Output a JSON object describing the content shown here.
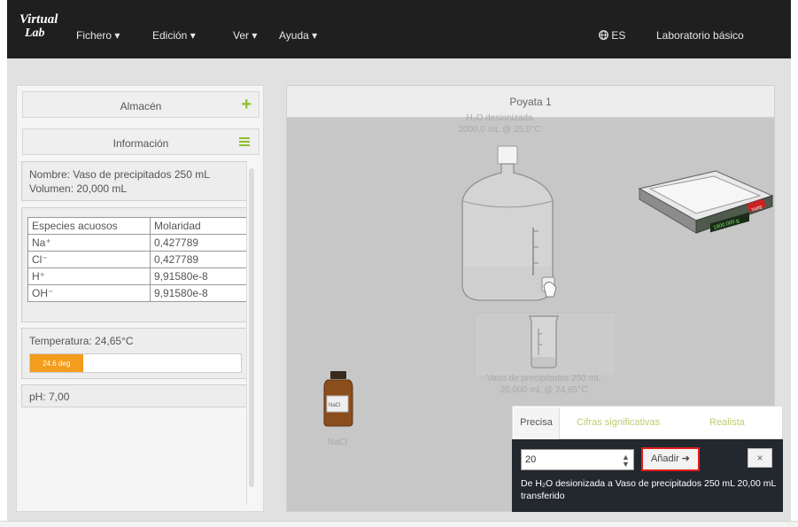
{
  "app": {
    "logo_line1": "Virtual",
    "logo_line2": "Lab",
    "menu": [
      "Fichero ▾",
      "Edición ▾",
      "Ver ▾",
      "Ayuda ▾"
    ],
    "language": "ES",
    "lab_name": "Laboratorio básico"
  },
  "left_panel": {
    "almacen_title": "Almacén",
    "info_title": "Información",
    "name_line": "Nombre: Vaso de precipitados 250 mL",
    "volume_line": "Volumen: 20,000 mL",
    "species_headers": [
      "Especies acuosos",
      "Molaridad"
    ],
    "species_rows": [
      [
        "Na⁺",
        "0,427789"
      ],
      [
        "Cl⁻",
        "0,427789"
      ],
      [
        "H⁺",
        "9,91580e-8"
      ],
      [
        "OH⁻",
        "9,91580e-8"
      ]
    ],
    "temperature_label": "Temperatura: 24,65°C",
    "temperature_bar_text": "24.6 deg",
    "temperature_fraction": 0.25,
    "ph_label": "pH: 7,00"
  },
  "bench": {
    "title": "Poyata 1",
    "water_label": "H₂O desionizada",
    "water_volume": "2000,0 mL @ 25,0°C",
    "scale_readout": "1800.000 g",
    "scale_tare": "TARE",
    "beaker_label": "Vaso de precipitados 250 mL",
    "beaker_volume": "20,000 mL @ 24,65°C",
    "nacl_label": "NaCl",
    "bottle_label": "NaCl"
  },
  "popover": {
    "tabs": [
      "Precisa",
      "Cifras significativas",
      "Realista"
    ],
    "input_value": "20",
    "add_label": "Añadir ➜",
    "close_label": "×",
    "message": "De H₂O desionizada a Vaso de precipitados 250 mL 20,00 mL transferido"
  },
  "colors": {
    "accent_green": "#8fbf2c",
    "temp_orange": "#f39c1e",
    "highlight_red": "#e21d1d",
    "navbar": "#1f1f1f"
  }
}
